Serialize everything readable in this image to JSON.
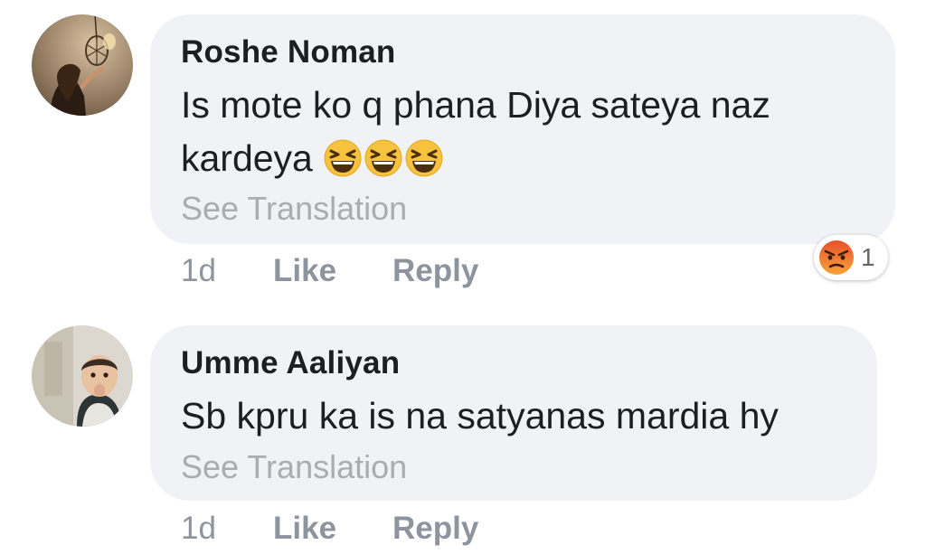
{
  "comments": [
    {
      "author": "Roshe Noman",
      "text_lines": [
        "Is mote ko q phana Diya sateya naz",
        "kardeya "
      ],
      "emojis": [
        "laughing-face",
        "laughing-face",
        "laughing-face"
      ],
      "translation_link": "See Translation",
      "time": "1d",
      "like_label": "Like",
      "reply_label": "Reply",
      "reaction": {
        "icon": "angry-face",
        "count": "1"
      }
    },
    {
      "author": "Umme Aaliyan",
      "text_lines": [
        "Sb kpru ka is na satyanas mardia hy"
      ],
      "translation_link": "See Translation",
      "time": "1d",
      "like_label": "Like",
      "reply_label": "Reply"
    }
  ],
  "colors": {
    "bubble": "#f0f2f5",
    "text": "#1c1e21",
    "secondary": "#8d949e",
    "translation": "#a9acb0",
    "emoji_yellow": "#f7c23e",
    "angry_orange": "#f07225"
  }
}
